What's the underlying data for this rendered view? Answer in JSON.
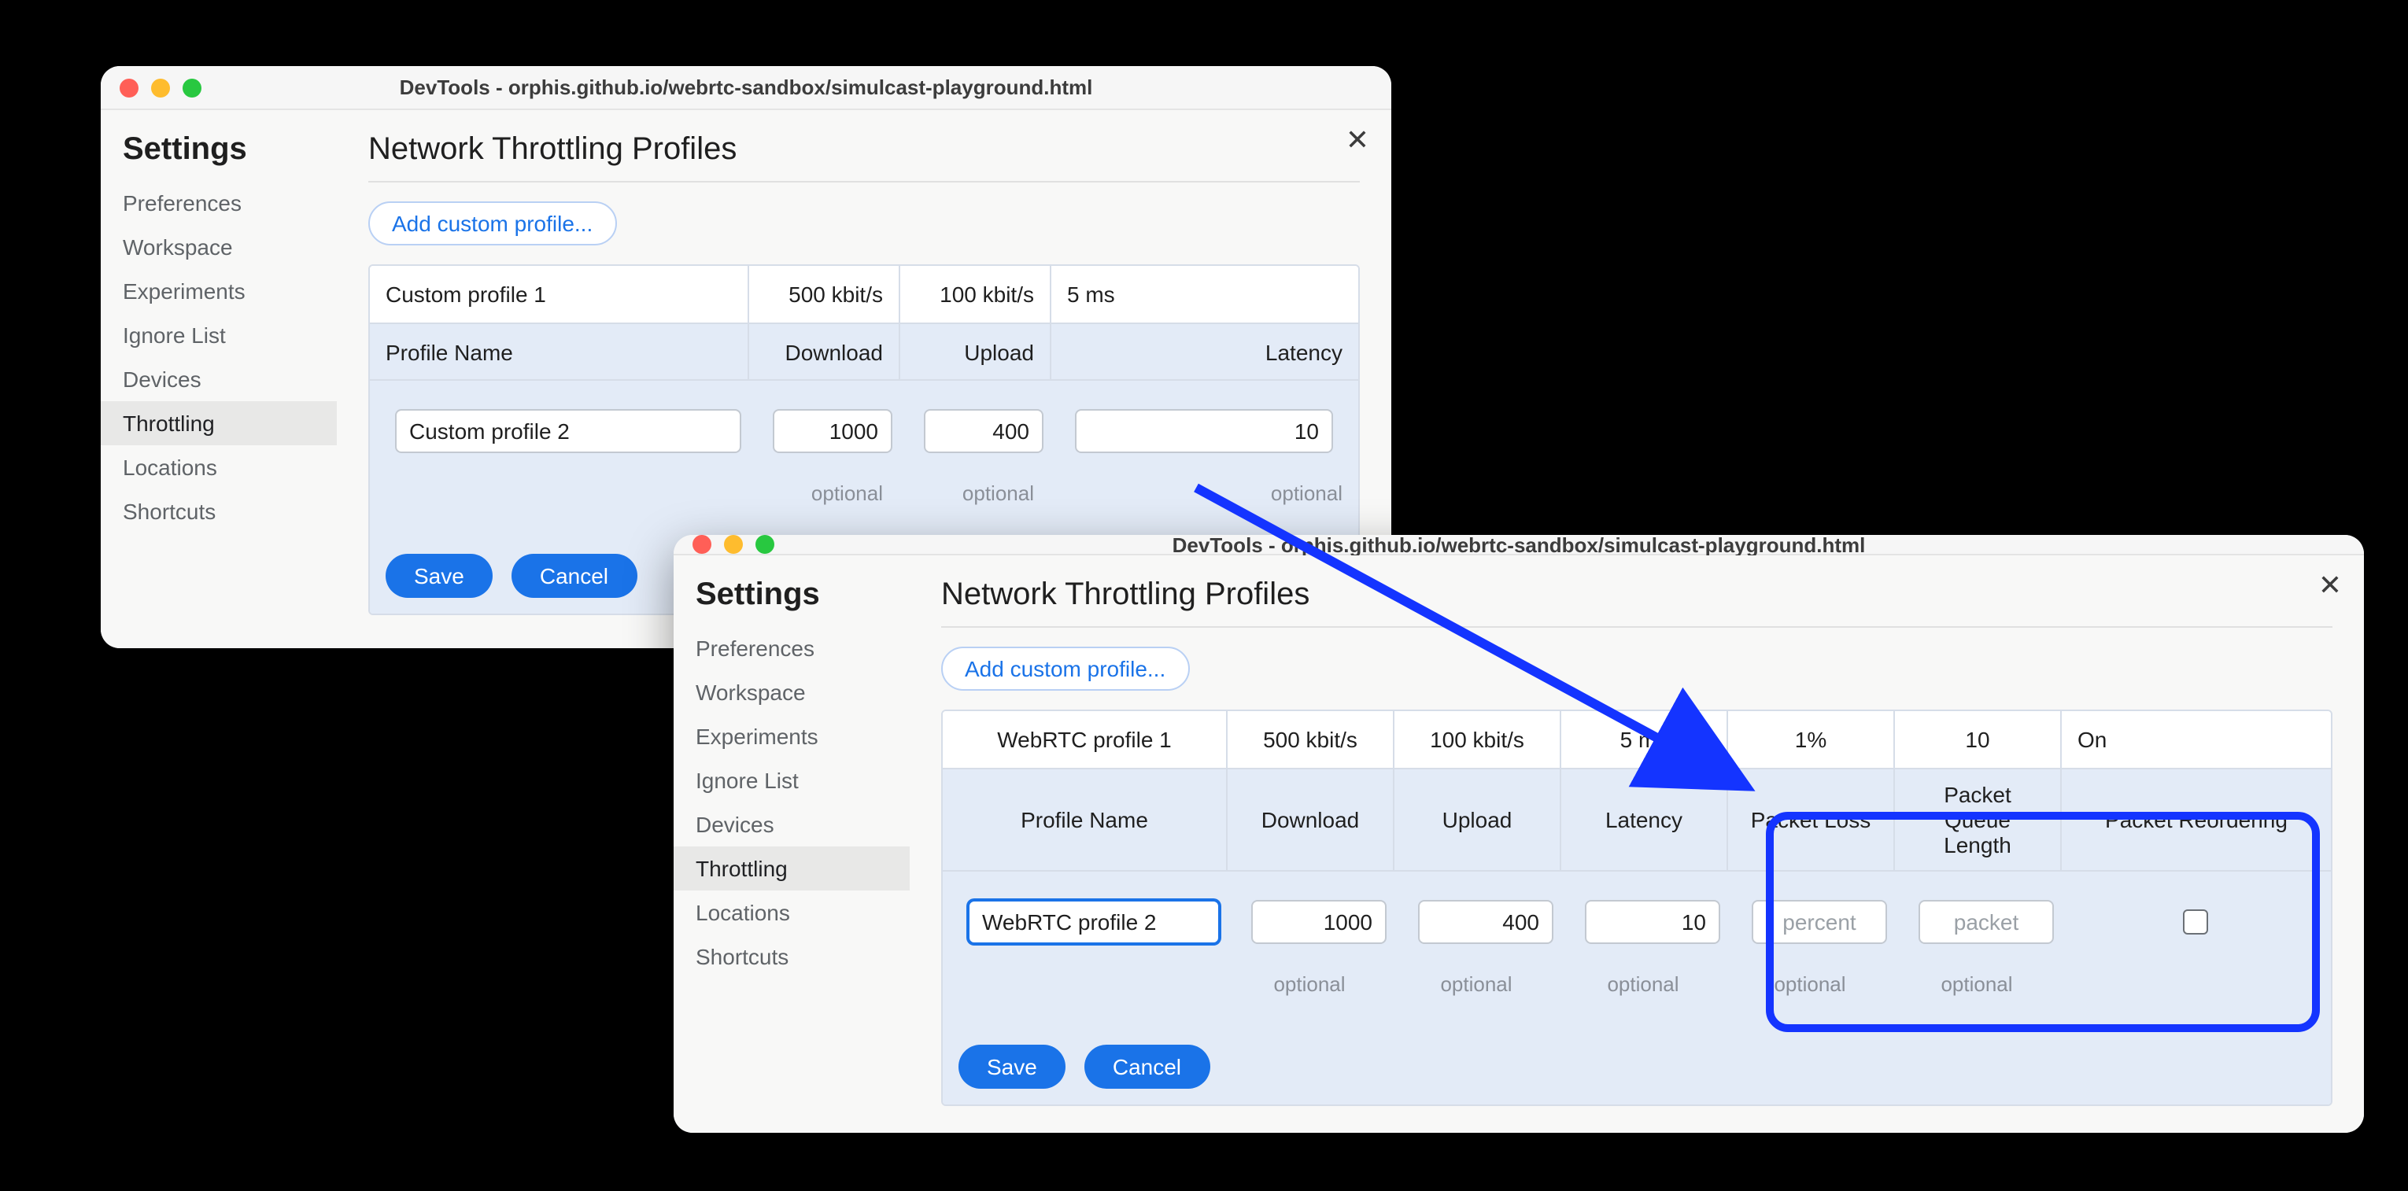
{
  "windows": {
    "before": {
      "title": "DevTools - orphis.github.io/webrtc-sandbox/simulcast-playground.html",
      "settings_label": "Settings",
      "nav": [
        "Preferences",
        "Workspace",
        "Experiments",
        "Ignore List",
        "Devices",
        "Throttling",
        "Locations",
        "Shortcuts"
      ],
      "active_nav": "Throttling",
      "heading": "Network Throttling Profiles",
      "add_button": "Add custom profile...",
      "columns": [
        "Profile Name",
        "Download",
        "Upload",
        "Latency"
      ],
      "existing_row": {
        "name": "Custom profile 1",
        "download": "500 kbit/s",
        "upload": "100 kbit/s",
        "latency": "5 ms"
      },
      "edit_row": {
        "name": "Custom profile 2",
        "download": "1000",
        "upload": "400",
        "latency": "10"
      },
      "helper": {
        "download": "optional",
        "upload": "optional",
        "latency": "optional"
      },
      "save": "Save",
      "cancel": "Cancel"
    },
    "after": {
      "title": "DevTools - orphis.github.io/webrtc-sandbox/simulcast-playground.html",
      "settings_label": "Settings",
      "nav": [
        "Preferences",
        "Workspace",
        "Experiments",
        "Ignore List",
        "Devices",
        "Throttling",
        "Locations",
        "Shortcuts"
      ],
      "active_nav": "Throttling",
      "heading": "Network Throttling Profiles",
      "add_button": "Add custom profile...",
      "columns": [
        "Profile Name",
        "Download",
        "Upload",
        "Latency",
        "Packet Loss",
        "Packet Queue Length",
        "Packet Reordering"
      ],
      "existing_row": {
        "name": "WebRTC profile 1",
        "download": "500 kbit/s",
        "upload": "100 kbit/s",
        "latency": "5 ms",
        "loss": "1%",
        "queue": "10",
        "reorder": "On"
      },
      "edit_row": {
        "name": "WebRTC profile 2",
        "download": "1000",
        "upload": "400",
        "latency": "10",
        "loss_ph": "percent",
        "queue_ph": "packet",
        "reorder_checked": false
      },
      "helper": {
        "download": "optional",
        "upload": "optional",
        "latency": "optional",
        "loss": "optional",
        "queue": "optional"
      },
      "save": "Save",
      "cancel": "Cancel"
    }
  }
}
